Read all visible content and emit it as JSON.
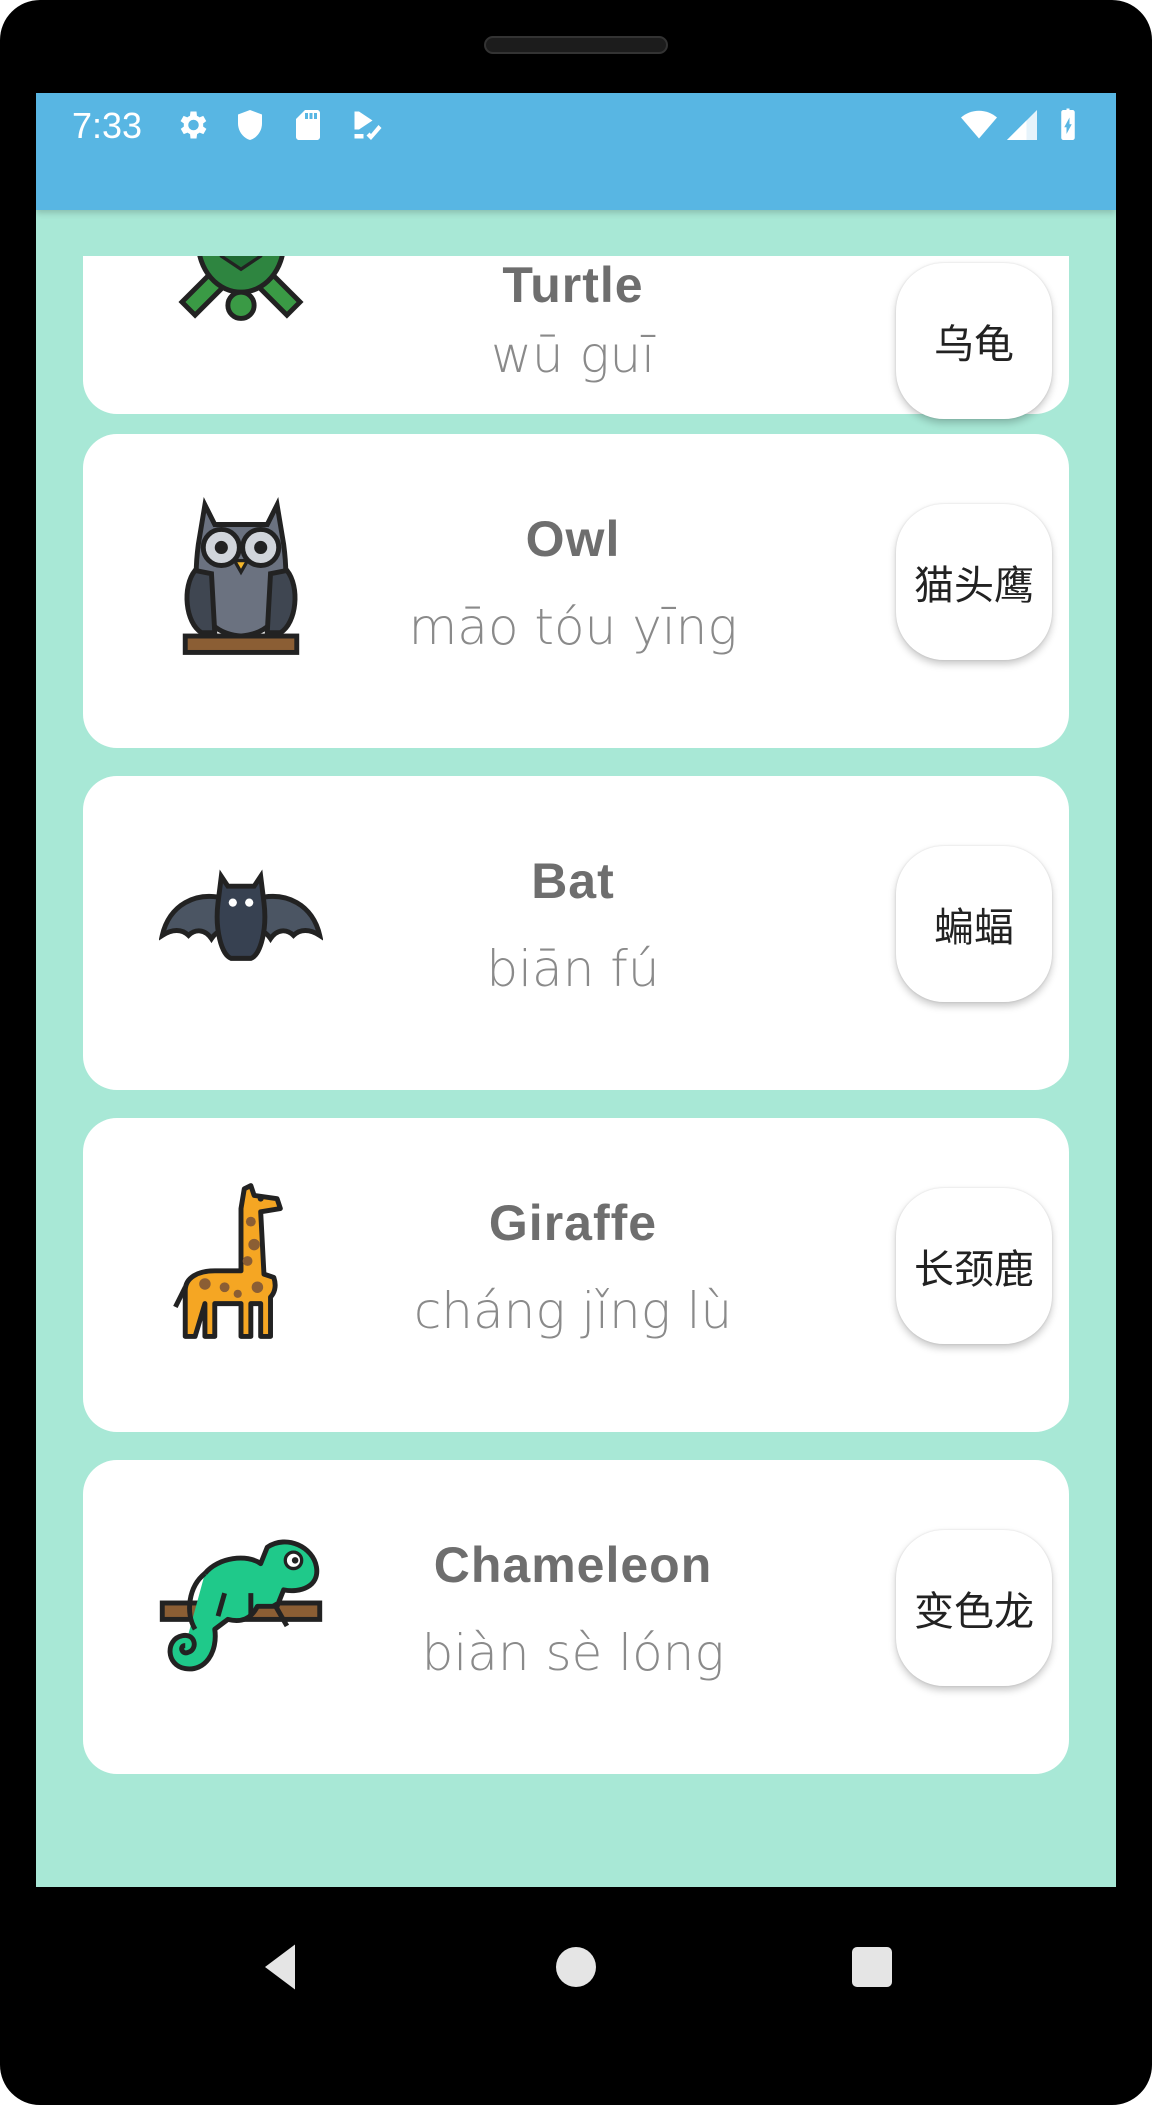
{
  "status_bar": {
    "time": "7:33",
    "left_icons": [
      "settings-gear-icon",
      "shield-icon",
      "sd-card-icon",
      "play-protect-icon"
    ],
    "right_icons": [
      "wifi-icon",
      "cell-signal-icon",
      "battery-charging-icon"
    ]
  },
  "colors": {
    "status_bar": "#58b6e3",
    "background": "#a8e8d6",
    "card": "#ffffff",
    "english_text": "#6e6e6e",
    "pinyin_text": "#8a8a8a"
  },
  "animals": [
    {
      "english": "Turtle",
      "pinyin": "wū guī",
      "hanzi": "乌龟",
      "icon": "turtle-icon"
    },
    {
      "english": "Owl",
      "pinyin": "māo tóu yīng",
      "hanzi": "猫头鹰",
      "icon": "owl-icon"
    },
    {
      "english": "Bat",
      "pinyin": "biān fú",
      "hanzi": "蝙蝠",
      "icon": "bat-icon"
    },
    {
      "english": "Giraffe",
      "pinyin": "cháng jǐng lù",
      "hanzi": "长颈鹿",
      "icon": "giraffe-icon"
    },
    {
      "english": "Chameleon",
      "pinyin": "biàn sè lóng",
      "hanzi": "变色龙",
      "icon": "chameleon-icon"
    }
  ],
  "nav_bar": {
    "buttons": [
      "back-icon",
      "home-icon",
      "recents-icon"
    ]
  }
}
